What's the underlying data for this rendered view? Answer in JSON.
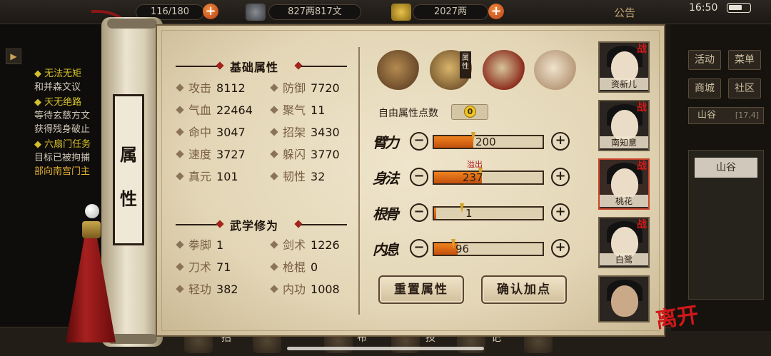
{
  "top_bar": {
    "bag_text": "116/180",
    "money_text": "827两817文",
    "gold_text": "2027两",
    "notice_label": "公告",
    "time": "16:50"
  },
  "quests": [
    {
      "title": "无法无矩",
      "lines": [
        "和并森文议"
      ]
    },
    {
      "title": "天无绝路",
      "lines": [
        "等待玄慈方文",
        "获得残身破止"
      ]
    },
    {
      "title": "六扇门任务",
      "lines": [
        "目标已被拘捕",
        "部向南宫门主"
      ]
    }
  ],
  "scroll_label": {
    "char1": "属",
    "char2": "性"
  },
  "base_attributes": {
    "title": "基础属性",
    "items": [
      {
        "label": "攻击",
        "value": "8112"
      },
      {
        "label": "防御",
        "value": "7720"
      },
      {
        "label": "气血",
        "value": "22464"
      },
      {
        "label": "聚气",
        "value": "11"
      },
      {
        "label": "命中",
        "value": "3047"
      },
      {
        "label": "招架",
        "value": "3430"
      },
      {
        "label": "速度",
        "value": "3727"
      },
      {
        "label": "躲闪",
        "value": "3770"
      },
      {
        "label": "真元",
        "value": "101"
      },
      {
        "label": "韧性",
        "value": "32"
      }
    ]
  },
  "martial": {
    "title": "武学修为",
    "items": [
      {
        "label": "拳脚",
        "value": "1"
      },
      {
        "label": "剑术",
        "value": "1226"
      },
      {
        "label": "刀术",
        "value": "71"
      },
      {
        "label": "枪棍",
        "value": "0"
      },
      {
        "label": "轻功",
        "value": "382"
      },
      {
        "label": "内功",
        "value": "1008"
      }
    ]
  },
  "category_tabs": {
    "icons": [
      "hat-icon",
      "attribute-scroll-icon",
      "bagua-icon",
      "body-meridian-icon"
    ],
    "active_badge": "属性"
  },
  "free_points": {
    "label": "自由属性点数",
    "value": "0"
  },
  "allocation": [
    {
      "name": "臂力",
      "value": "200",
      "fill": 0.36
    },
    {
      "name": "身法",
      "value": "237",
      "fill": 0.44,
      "note": "溢出"
    },
    {
      "name": "根骨",
      "value": "1",
      "fill": 0.02
    },
    {
      "name": "内息",
      "value": "96",
      "fill": 0.22
    }
  ],
  "buttons": {
    "reset": "重置属性",
    "confirm": "确认加点"
  },
  "characters": [
    {
      "name": "资新儿",
      "battle": "战"
    },
    {
      "name": "南知意",
      "battle": "战"
    },
    {
      "name": "桃花",
      "battle": "战",
      "selected": true
    },
    {
      "name": "白鹭",
      "battle": "战"
    },
    {
      "name": "",
      "battle": ""
    }
  ],
  "leave_label": "离开",
  "side_menu": {
    "activity": "活动",
    "menu": "菜单",
    "shop": "商城",
    "community": "社区",
    "location": "山谷",
    "coords": "[17,4]",
    "location_item": "山谷"
  },
  "bottom_labels": [
    "招",
    "布",
    "技",
    "记"
  ]
}
